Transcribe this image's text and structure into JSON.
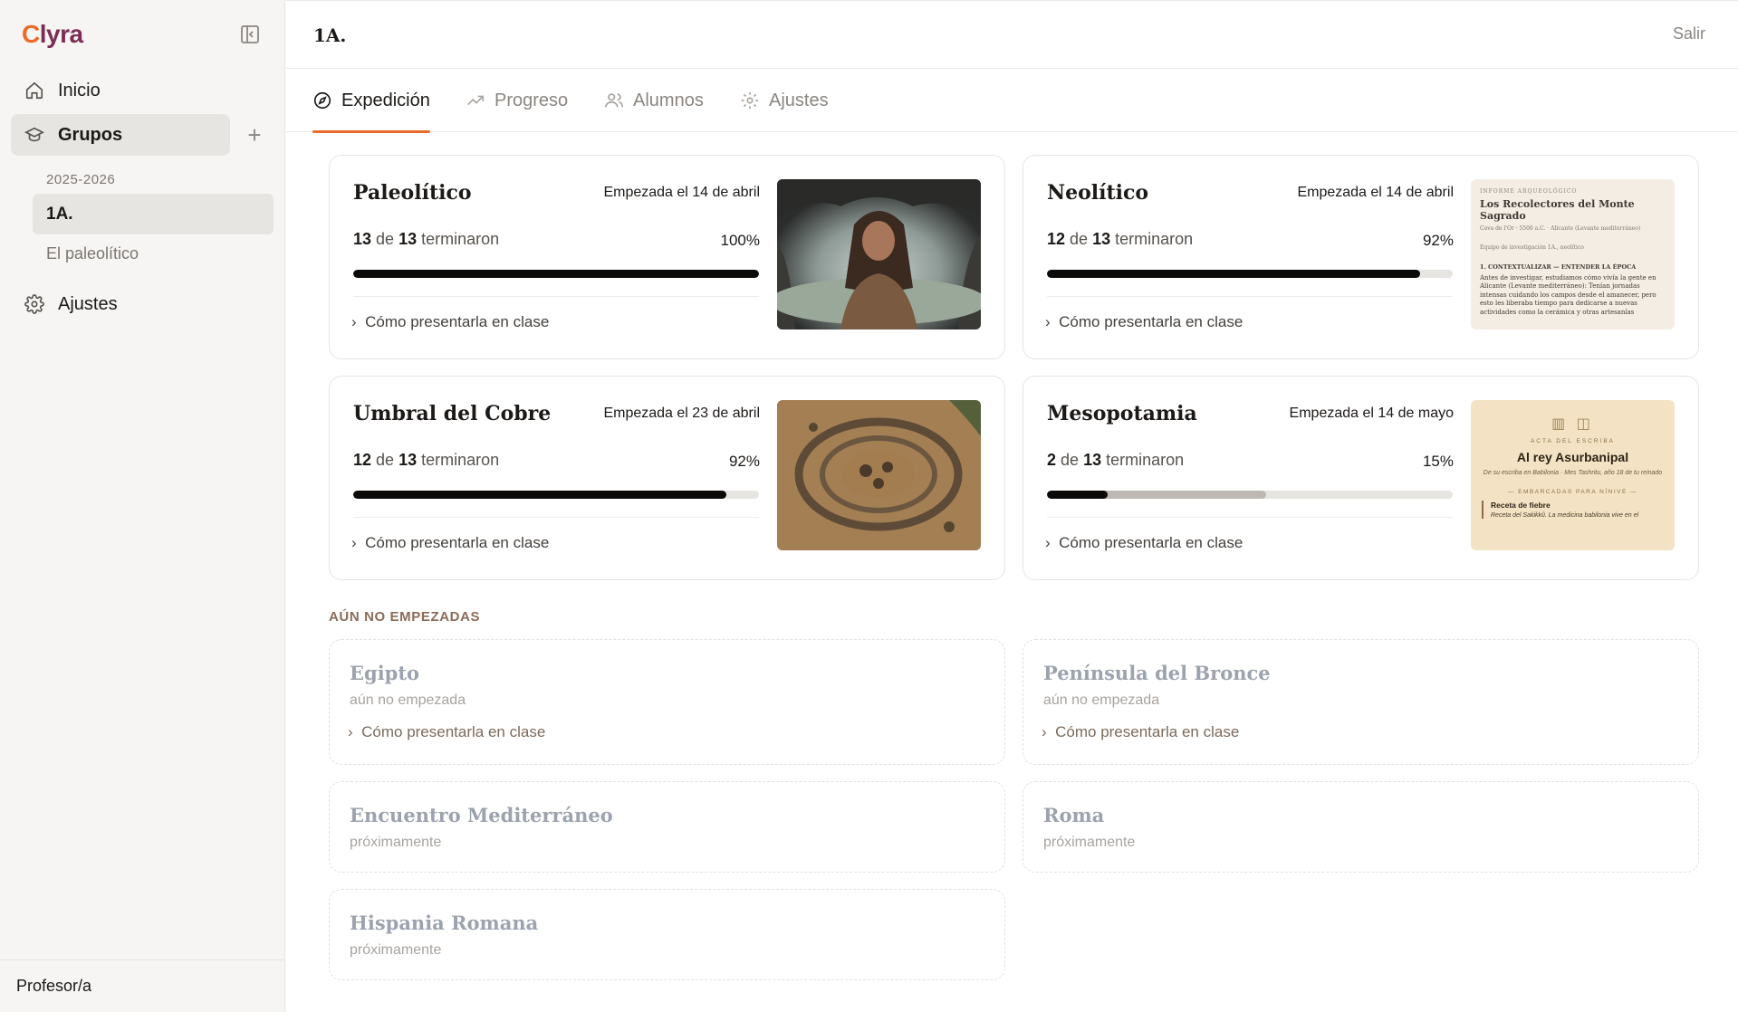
{
  "app": {
    "logo_first": "C",
    "logo_rest": "lyra"
  },
  "sidebar": {
    "nav": [
      {
        "label": "Inicio",
        "icon": "home-icon"
      },
      {
        "label": "Grupos",
        "icon": "graduation-cap-icon"
      },
      {
        "label": "Ajustes",
        "icon": "gear-icon"
      }
    ],
    "year": "2025-2026",
    "group": "1A.",
    "group_sub": "El paleolítico",
    "footer": "Profesor/a"
  },
  "header": {
    "title": "1A.",
    "logout": "Salir"
  },
  "tabs": [
    {
      "label": "Expedición",
      "icon": "compass-icon"
    },
    {
      "label": "Progreso",
      "icon": "trend-up-icon"
    },
    {
      "label": "Alumnos",
      "icon": "users-icon"
    },
    {
      "label": "Ajustes",
      "icon": "gear-icon"
    }
  ],
  "started": [
    {
      "title": "Paleolítico",
      "started": "Empezada el 14 de abril",
      "done": "13",
      "of": "de",
      "total": "13",
      "word": "terminaron",
      "pct": "100%",
      "progress": 1.0,
      "started_progress": 1.0,
      "link": "Cómo presentarla en clase"
    },
    {
      "title": "Neolítico",
      "started": "Empezada el 14 de abril",
      "done": "12",
      "of": "de",
      "total": "13",
      "word": "terminaron",
      "pct": "92%",
      "progress": 0.92,
      "started_progress": 0.92,
      "link": "Cómo presentarla en clase"
    },
    {
      "title": "Umbral del Cobre",
      "started": "Empezada el 23 de abril",
      "done": "12",
      "of": "de",
      "total": "13",
      "word": "terminaron",
      "pct": "92%",
      "progress": 0.92,
      "started_progress": 0.92,
      "link": "Cómo presentarla en clase"
    },
    {
      "title": "Mesopotamia",
      "started": "Empezada el 14 de mayo",
      "done": "2",
      "of": "de",
      "total": "13",
      "word": "terminaron",
      "pct": "15%",
      "progress": 0.15,
      "started_progress": 0.54,
      "link": "Cómo presentarla en clase"
    }
  ],
  "doc_neolitico": {
    "kicker": "INFORME ARQUEOLÓGICO",
    "title": "Los Recolectores del Monte Sagrado",
    "meta": "Cova de l'Or · 5500 a.C. · Alicante (Levante mediterráneo)",
    "team": "Equipo de investigación 1A., neolítico",
    "section": "1. CONTEXTUALIZAR — ENTENDER LA ÉPOCA",
    "body": "Antes de investigar, estudiamos cómo vivía la gente en Alicante (Levante mediterráneo): Tenían jornadas intensas cuidando los campos desde el amanecer, pero esto les liberaba tiempo para dedicarse a nuevas actividades como la cerámica y otras artesanías"
  },
  "doc_meso": {
    "kicker": "ACTA DEL ESCRIBA",
    "title": "Al rey Asurbanipal",
    "sub": "De su escriba en Babilonia · Mes Tashritu, año 18 de tu reinado",
    "section": "— EMBARCADAS PARA NÍNIVE —",
    "item_title": "Receta de fiebre",
    "item_body": "Receta del Sakikkû. La medicina babilonia vive en el"
  },
  "not_started_label": "AÚN NO EMPEZADAS",
  "not_started": [
    {
      "title": "Egipto",
      "sub": "aún no empezada",
      "link": "Cómo presentarla en clase"
    },
    {
      "title": "Península del Bronce",
      "sub": "aún no empezada",
      "link": "Cómo presentarla en clase"
    },
    {
      "title": "Encuentro Mediterráneo",
      "sub": "próximamente"
    },
    {
      "title": "Roma",
      "sub": "próximamente"
    },
    {
      "title": "Hispania Romana",
      "sub": "próximamente"
    }
  ],
  "colors": {
    "accent": "#ea6a2a",
    "brand": "#7a2d55",
    "bar": "#0c0a09"
  }
}
